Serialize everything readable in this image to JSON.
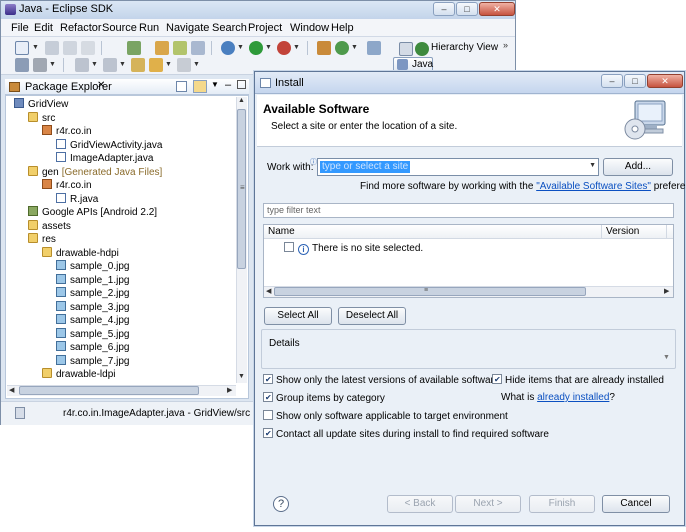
{
  "eclipse": {
    "title": "Java - Eclipse SDK",
    "menu": [
      "File",
      "Edit",
      "Refactor",
      "Source",
      "Run",
      "Navigate",
      "Search",
      "Project",
      "Window",
      "Help"
    ],
    "hierarchy_view_label": "Hierarchy View",
    "perspective_label": "Java",
    "package_explorer_title": "Package Explorer",
    "tree": [
      {
        "label": "GridView",
        "icon": "project-icon",
        "indent": 0
      },
      {
        "label": "src",
        "icon": "folder-icon",
        "indent": 1
      },
      {
        "label": "r4r.co.in",
        "icon": "package-icon",
        "indent": 2
      },
      {
        "label": "GridViewActivity.java",
        "icon": "java-file-icon",
        "indent": 3
      },
      {
        "label": "ImageAdapter.java",
        "icon": "java-file-icon",
        "indent": 3
      },
      {
        "label": "gen",
        "icon": "folder-icon",
        "indent": 1,
        "suffix": "[Generated Java Files]"
      },
      {
        "label": "r4r.co.in",
        "icon": "package-icon",
        "indent": 2
      },
      {
        "label": "R.java",
        "icon": "java-file-icon",
        "indent": 3
      },
      {
        "label": "Google APIs [Android 2.2]",
        "icon": "library-icon",
        "indent": 1
      },
      {
        "label": "assets",
        "icon": "folder-icon",
        "indent": 1
      },
      {
        "label": "res",
        "icon": "folder-icon",
        "indent": 1
      },
      {
        "label": "drawable-hdpi",
        "icon": "folder-icon",
        "indent": 2
      },
      {
        "label": "sample_0.jpg",
        "icon": "image-file-icon",
        "indent": 3
      },
      {
        "label": "sample_1.jpg",
        "icon": "image-file-icon",
        "indent": 3
      },
      {
        "label": "sample_2.jpg",
        "icon": "image-file-icon",
        "indent": 3
      },
      {
        "label": "sample_3.jpg",
        "icon": "image-file-icon",
        "indent": 3
      },
      {
        "label": "sample_4.jpg",
        "icon": "image-file-icon",
        "indent": 3
      },
      {
        "label": "sample_5.jpg",
        "icon": "image-file-icon",
        "indent": 3
      },
      {
        "label": "sample_6.jpg",
        "icon": "image-file-icon",
        "indent": 3
      },
      {
        "label": "sample_7.jpg",
        "icon": "image-file-icon",
        "indent": 3
      },
      {
        "label": "drawable-ldpi",
        "icon": "folder-icon",
        "indent": 2
      }
    ],
    "status_text": "r4r.co.in.ImageAdapter.java - GridView/src"
  },
  "install": {
    "title": "Install",
    "heading": "Available Software",
    "subheading": "Select a site or enter the location of a site.",
    "work_with_label": "Work with:",
    "work_with_value": "type or select a site",
    "add_button": "Add...",
    "find_more_prefix": "Find more software by working with the ",
    "find_more_link": "\"Available Software Sites\"",
    "find_more_suffix": " preferences.",
    "filter_placeholder": "type filter text",
    "columns": {
      "name": "Name",
      "version": "Version"
    },
    "no_site_message": "There is no site selected.",
    "select_all": "Select All",
    "deselect_all": "Deselect All",
    "details_label": "Details",
    "options": {
      "latest_versions": {
        "label": "Show only the latest versions of available software",
        "checked": true
      },
      "hide_installed": {
        "label": "Hide items that are already installed",
        "checked": true
      },
      "group_by_category": {
        "label": "Group items by category",
        "checked": true
      },
      "what_is_prefix": "What is ",
      "what_is_link": "already installed",
      "what_is_suffix": "?",
      "target_env": {
        "label": "Show only software applicable to target environment",
        "checked": false
      },
      "contact_sites": {
        "label": "Contact all update sites during install to find required software",
        "checked": true
      }
    },
    "buttons": {
      "back": "< Back",
      "next": "Next >",
      "finish": "Finish",
      "cancel": "Cancel"
    }
  },
  "colors": {
    "selection": "#3399ff",
    "link": "#0b50c1"
  }
}
